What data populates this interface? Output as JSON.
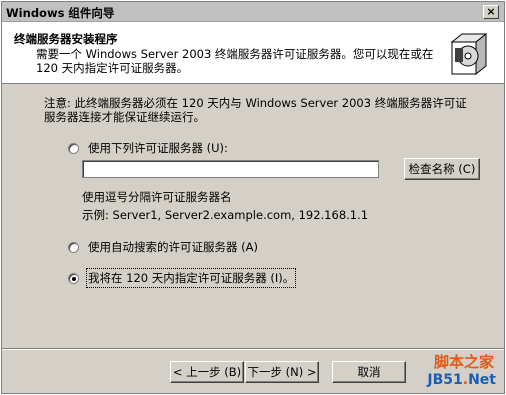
{
  "window": {
    "title": "Windows 组件向导",
    "close_glyph": "×"
  },
  "header": {
    "title": "终端服务器安装程序",
    "subtitle": "需要一个 Windows Server 2003 终端服务器许可证服务器。您可以现在或在 120 天内指定许可证服务器。"
  },
  "note": "注意: 此终端服务器必须在 120 天内与 Windows Server 2003 终端服务器许可证服务器连接才能保证继续运行。",
  "options": [
    {
      "label": "使用下列许可证服务器 (U):",
      "selected": false
    },
    {
      "label": "使用自动搜索的许可证服务器 (A)",
      "selected": false
    },
    {
      "label": "我将在 120 天内指定许可证服务器 (I)。",
      "selected": true
    }
  ],
  "server_input": {
    "value": ""
  },
  "check_names_button": "检查名称 (C)",
  "hint": {
    "line1": "使用逗号分隔许可证服务器名",
    "line2": "示例: Server1, Server2.example.com, 192.168.1.1"
  },
  "buttons": {
    "back": "< 上一步 (B)",
    "next": "下一步 (N) >",
    "cancel": "取消"
  },
  "watermark": {
    "site": "脚本之家",
    "domain": "JB51",
    "dot": ".",
    "tld": "Net"
  }
}
